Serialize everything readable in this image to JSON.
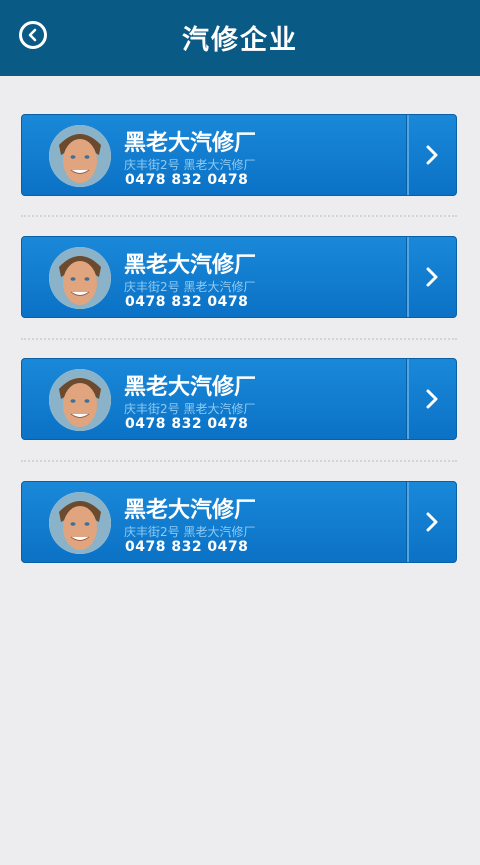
{
  "header": {
    "title": "汽修企业"
  },
  "list": [
    {
      "name": "黑老大汽修厂",
      "address": "庆丰街2号  黑老大汽修厂",
      "phone": "0478 832 0478"
    },
    {
      "name": "黑老大汽修厂",
      "address": "庆丰街2号  黑老大汽修厂",
      "phone": "0478 832 0478"
    },
    {
      "name": "黑老大汽修厂",
      "address": "庆丰街2号  黑老大汽修厂",
      "phone": "0478 832 0478"
    },
    {
      "name": "黑老大汽修厂",
      "address": "庆丰街2号  黑老大汽修厂",
      "phone": "0478 832 0478"
    }
  ],
  "colors": {
    "header": "#0a5a86",
    "card": "#1583d3",
    "background": "#edecee"
  }
}
